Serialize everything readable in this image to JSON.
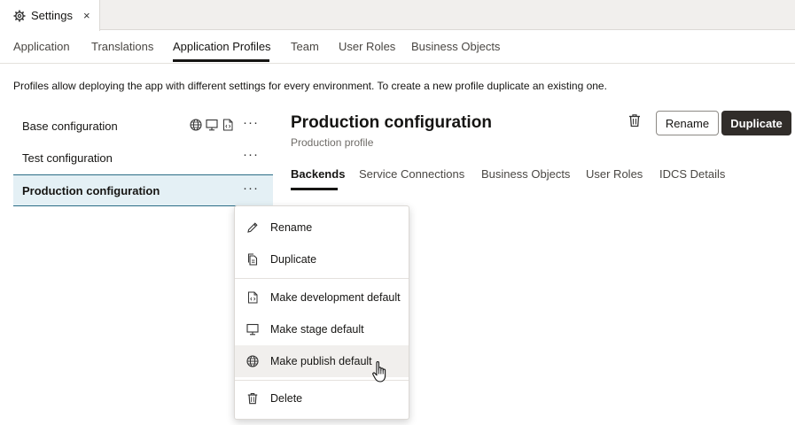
{
  "doc_tab": {
    "title": "Settings",
    "close": "×"
  },
  "nav_tabs": [
    {
      "label": "Application"
    },
    {
      "label": "Translations"
    },
    {
      "label": "Application Profiles"
    },
    {
      "label": "Team"
    },
    {
      "label": "User Roles"
    },
    {
      "label": "Business Objects"
    }
  ],
  "nav_active": "Application Profiles",
  "description": "Profiles allow deploying the app with different settings for every environment. To create a new profile duplicate an existing one.",
  "profiles": [
    {
      "name": "Base configuration",
      "default_icons": [
        "globe-icon",
        "monitor-icon",
        "code-file-icon"
      ]
    },
    {
      "name": "Test configuration"
    },
    {
      "name": "Production configuration",
      "selected": true
    }
  ],
  "kebab": "···",
  "detail": {
    "title": "Production configuration",
    "subtitle": "Production profile",
    "rename_label": "Rename",
    "duplicate_label": "Duplicate",
    "tabs": [
      {
        "label": "Backends"
      },
      {
        "label": "Service Connections"
      },
      {
        "label": "Business Objects"
      },
      {
        "label": "User Roles"
      },
      {
        "label": "IDCS Details"
      }
    ],
    "active_tab": "Backends"
  },
  "menu": {
    "items": [
      {
        "label": "Rename",
        "icon": "pencil-icon"
      },
      {
        "label": "Duplicate",
        "icon": "duplicate-icon"
      },
      {
        "label": "Make development default",
        "icon": "code-file-icon"
      },
      {
        "label": "Make stage default",
        "icon": "monitor-icon"
      },
      {
        "label": "Make publish default",
        "icon": "globe-icon",
        "hovered": true
      },
      {
        "label": "Delete",
        "icon": "trash-icon"
      }
    ]
  },
  "colors": {
    "selected_bg": "#e4f0f5",
    "selected_border": "#2b6c85",
    "primary_button": "#312d2a",
    "tab_bar_bg": "#f1efed"
  }
}
